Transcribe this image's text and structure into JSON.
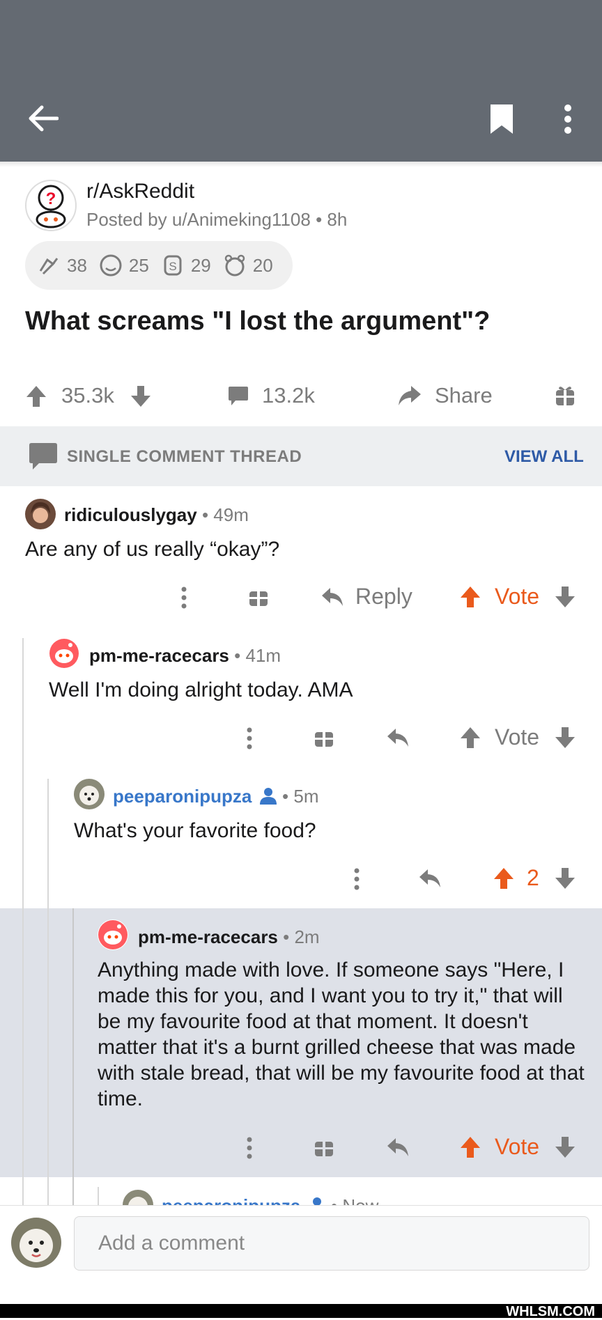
{
  "post": {
    "subreddit": "r/AskReddit",
    "posted_by": "Posted by u/Animeking1108",
    "time": "8h",
    "awards": [
      {
        "icon": "hugz-award-icon",
        "count": "38"
      },
      {
        "icon": "wholesome-award-icon",
        "count": "25"
      },
      {
        "icon": "silver-award-icon",
        "count": "29"
      },
      {
        "icon": "bear-award-icon",
        "count": "20"
      }
    ],
    "title": "What screams \"I lost the argument\"?",
    "score": "35.3k",
    "comments": "13.2k",
    "share_label": "Share"
  },
  "thread": {
    "label": "SINGLE COMMENT THREAD",
    "view_all": "VIEW ALL"
  },
  "comments": [
    {
      "user": "ridiculouslygay",
      "time": "49m",
      "text": "Are any of us really “okay”?",
      "reply_label": "Reply",
      "vote_label": "Vote"
    },
    {
      "user": "pm-me-racecars",
      "time": "41m",
      "text": "Well I'm doing alright today. AMA",
      "vote_label": "Vote"
    },
    {
      "user": "peeparonipupza",
      "time": "5m",
      "text": "What's your favorite food?",
      "score": "2"
    },
    {
      "user": "pm-me-racecars",
      "time": "2m",
      "text": "Anything made with love. If someone says \"Here, I made this for you, and I want you to try it,\" that will be my favourite food at that moment. It doesn't matter that it's a burnt grilled cheese that was made with stale bread, that will be my favourite food at that time.",
      "vote_label": "Vote"
    },
    {
      "user": "peeparonipupza",
      "time": "Now"
    }
  ],
  "composer": {
    "placeholder": "Add a comment"
  },
  "watermark": "WHLSM.COM",
  "colors": {
    "topbar": "#646a72",
    "upvote": "#ea5a1c",
    "link_blue": "#2e5aa6",
    "op_blue": "#3877c9",
    "highlight": "#dee1e8"
  }
}
